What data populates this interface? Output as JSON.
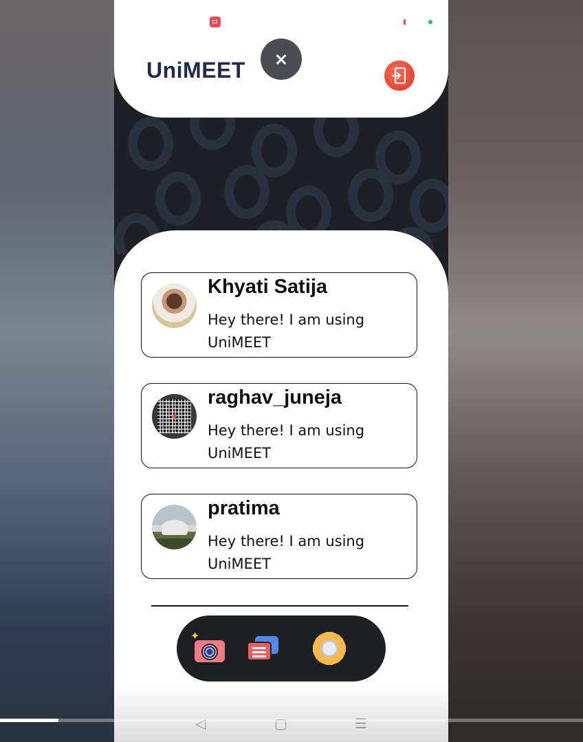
{
  "header": {
    "app_title": "UniMEET"
  },
  "contacts": [
    {
      "name": "Khyati Satija",
      "status": "Hey there! I am using UniMEET"
    },
    {
      "name": "raghav_juneja",
      "status": "Hey there! I am using UniMEET"
    },
    {
      "name": "pratima",
      "status": "Hey there! I am using UniMEET"
    }
  ],
  "nav": {
    "items": [
      {
        "icon": "camera-icon"
      },
      {
        "icon": "chat-icon"
      },
      {
        "icon": "settings-icon"
      }
    ]
  },
  "system_nav": {
    "back": "◁",
    "home": "▢",
    "menu": "☰"
  },
  "video": {
    "progress": 0.1
  },
  "colors": {
    "title": "#222a4a",
    "close_button": "#4a4d52",
    "logout_button": "#e4352c",
    "navbar": "#1e2124"
  }
}
